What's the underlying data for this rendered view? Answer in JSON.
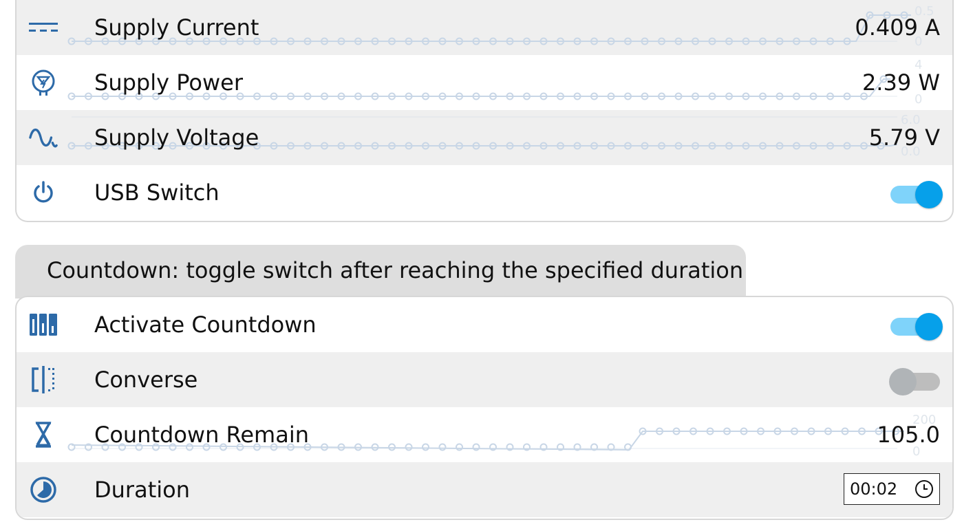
{
  "colors": {
    "accent": "#06a0ea",
    "icon": "#2d6aa8",
    "row_alt": "#efefef"
  },
  "sensors": [
    {
      "label": "Supply Current",
      "value": "0.409 A",
      "icon": "dc-current-icon",
      "axis_max": "0.5",
      "axis_min": "0"
    },
    {
      "label": "Supply Power",
      "value": "2.39 W",
      "icon": "power-plug-icon",
      "axis_max": "4",
      "axis_min": "0"
    },
    {
      "label": "Supply Voltage",
      "value": "5.79 V",
      "icon": "sine-wave-icon",
      "axis_max": "6.0",
      "axis_min": "0.0"
    }
  ],
  "usb_switch": {
    "label": "USB Switch",
    "state": true,
    "icon": "power-icon"
  },
  "countdown": {
    "tab_title": "Countdown: toggle switch after reaching the specified duration",
    "activate": {
      "label": "Activate Countdown",
      "state": true,
      "icon": "columns-icon"
    },
    "converse": {
      "label": "Converse",
      "state": false,
      "icon": "compare-icon"
    },
    "remain": {
      "label": "Countdown Remain",
      "value": "105.0",
      "icon": "hourglass-icon",
      "axis_max": "200",
      "axis_min": "0"
    },
    "duration": {
      "label": "Duration",
      "value": "00:02",
      "icon": "timelapse-icon"
    }
  }
}
